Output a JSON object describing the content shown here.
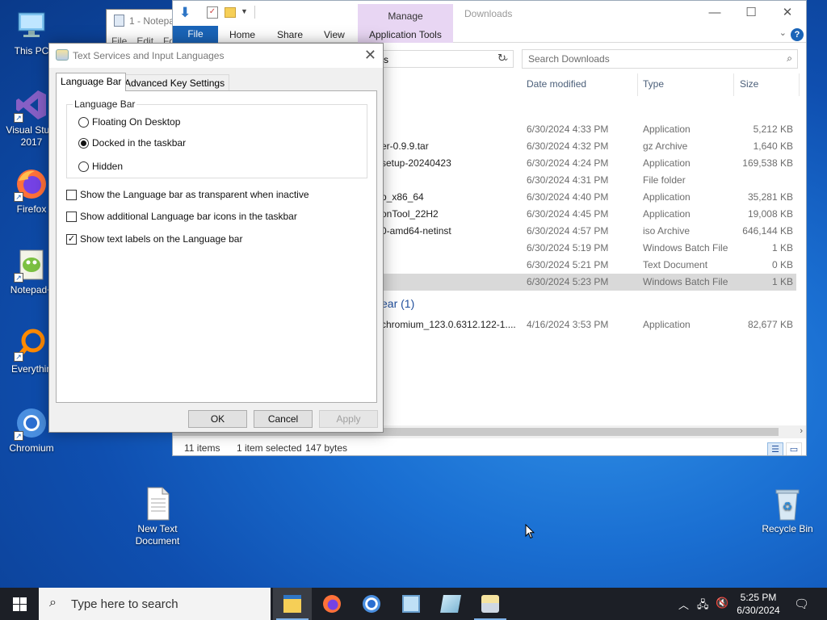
{
  "desktop": {
    "icons": [
      {
        "label": "This PC"
      },
      {
        "label": "Visual Studio 2017",
        "label_lines": [
          "Visual Studi",
          "2017"
        ]
      },
      {
        "label": "Firefox"
      },
      {
        "label": "Notepad+"
      },
      {
        "label": "Everythin"
      },
      {
        "label": "Chromium"
      },
      {
        "label_lines": [
          "New Text",
          "Document"
        ]
      },
      {
        "label": "Recycle Bin"
      }
    ]
  },
  "notepad": {
    "title": "1 - Notepa",
    "menu": [
      "File",
      "Edit",
      "Fo"
    ]
  },
  "explorer": {
    "window_title": "Downloads",
    "contextual_tab": "Manage",
    "ribbon_tabs": [
      "File",
      "Home",
      "Share",
      "View",
      "Application Tools"
    ],
    "search_placeholder": "Search Downloads",
    "address_fragment": "s",
    "columns": [
      "Date modified",
      "Type",
      "Size"
    ],
    "rows": [
      {
        "name": "",
        "date": "6/30/2024 4:33 PM",
        "type": "Application",
        "size": "5,212 KB"
      },
      {
        "name": "er-0.9.9.tar",
        "date": "6/30/2024 4:32 PM",
        "type": "gz Archive",
        "size": "1,640 KB"
      },
      {
        "name": "setup-20240423",
        "date": "6/30/2024 4:24 PM",
        "type": "Application",
        "size": "169,538 KB"
      },
      {
        "name": "",
        "date": "6/30/2024 4:31 PM",
        "type": "File folder",
        "size": ""
      },
      {
        "name": "p_x86_64",
        "date": "6/30/2024 4:40 PM",
        "type": "Application",
        "size": "35,281 KB"
      },
      {
        "name": "onTool_22H2",
        "date": "6/30/2024 4:45 PM",
        "type": "Application",
        "size": "19,008 KB"
      },
      {
        "name": "0-amd64-netinst",
        "date": "6/30/2024 4:57 PM",
        "type": "iso Archive",
        "size": "646,144 KB"
      },
      {
        "name": "",
        "date": "6/30/2024 5:19 PM",
        "type": "Windows Batch File",
        "size": "1 KB"
      },
      {
        "name": "",
        "date": "6/30/2024 5:21 PM",
        "type": "Text Document",
        "size": "0 KB"
      },
      {
        "name": "",
        "date": "6/30/2024 5:23 PM",
        "type": "Windows Batch File",
        "size": "1 KB",
        "selected": true
      }
    ],
    "group_header": "ear (1)",
    "group_rows": [
      {
        "name": "chromium_123.0.6312.122-1....",
        "date": "4/16/2024 3:53 PM",
        "type": "Application",
        "size": "82,677 KB"
      }
    ],
    "status": {
      "items": "11 items",
      "selected": "1 item selected",
      "bytes": "147 bytes"
    }
  },
  "dialog": {
    "title": "Text Services and Input Languages",
    "tabs": [
      "Language Bar",
      "Advanced Key Settings"
    ],
    "group_label": "Language Bar",
    "radios": [
      {
        "label": "Floating On Desktop",
        "checked": false
      },
      {
        "label": "Docked in the taskbar",
        "checked": true
      },
      {
        "label": "Hidden",
        "checked": false
      }
    ],
    "checkboxes": [
      {
        "label": "Show the Language bar as transparent when inactive",
        "checked": false
      },
      {
        "label": "Show additional Language bar icons in the taskbar",
        "checked": false
      },
      {
        "label": "Show text labels on the Language bar",
        "checked": true
      }
    ],
    "buttons": {
      "ok": "OK",
      "cancel": "Cancel",
      "apply": "Apply"
    }
  },
  "taskbar": {
    "search_text": "Type here to search",
    "time": "5:25 PM",
    "date": "6/30/2024"
  }
}
